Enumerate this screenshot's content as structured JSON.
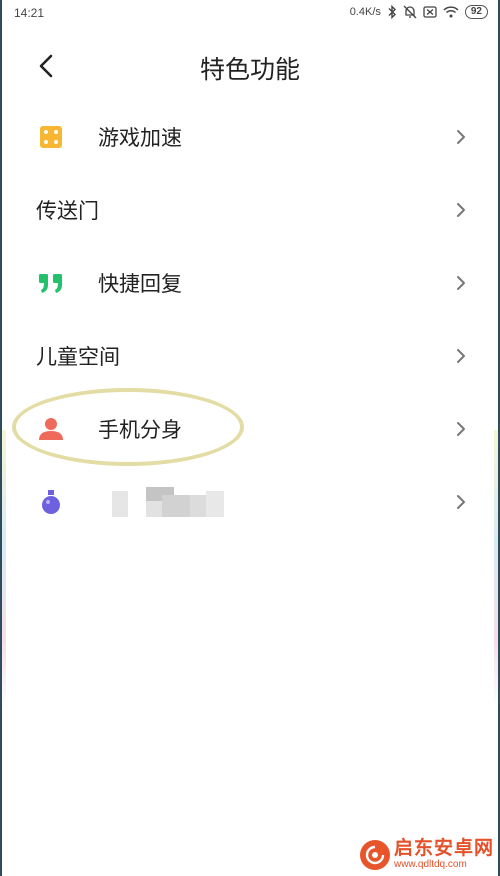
{
  "status_bar": {
    "time": "14:21",
    "net_speed": "0.4K/s",
    "battery": "92"
  },
  "header": {
    "title": "特色功能"
  },
  "menu": {
    "items": [
      {
        "label": "游戏加速",
        "icon": "dice-icon",
        "icon_color": "#f7b733"
      },
      {
        "label": "传送门",
        "icon": ""
      },
      {
        "label": "快捷回复",
        "icon": "quote-icon",
        "icon_color": "#23c16b"
      },
      {
        "label": "儿童空间",
        "icon": ""
      },
      {
        "label": "手机分身",
        "icon": "person-icon",
        "icon_color": "#f06a5b"
      },
      {
        "label": "",
        "icon": "flask-icon",
        "icon_color": "#6e61e0"
      }
    ]
  },
  "watermark": {
    "title": "启东安卓网",
    "url": "www.qdltdq.com"
  },
  "colors": {
    "highlight": "#e3dca4",
    "chevron": "#777777"
  }
}
